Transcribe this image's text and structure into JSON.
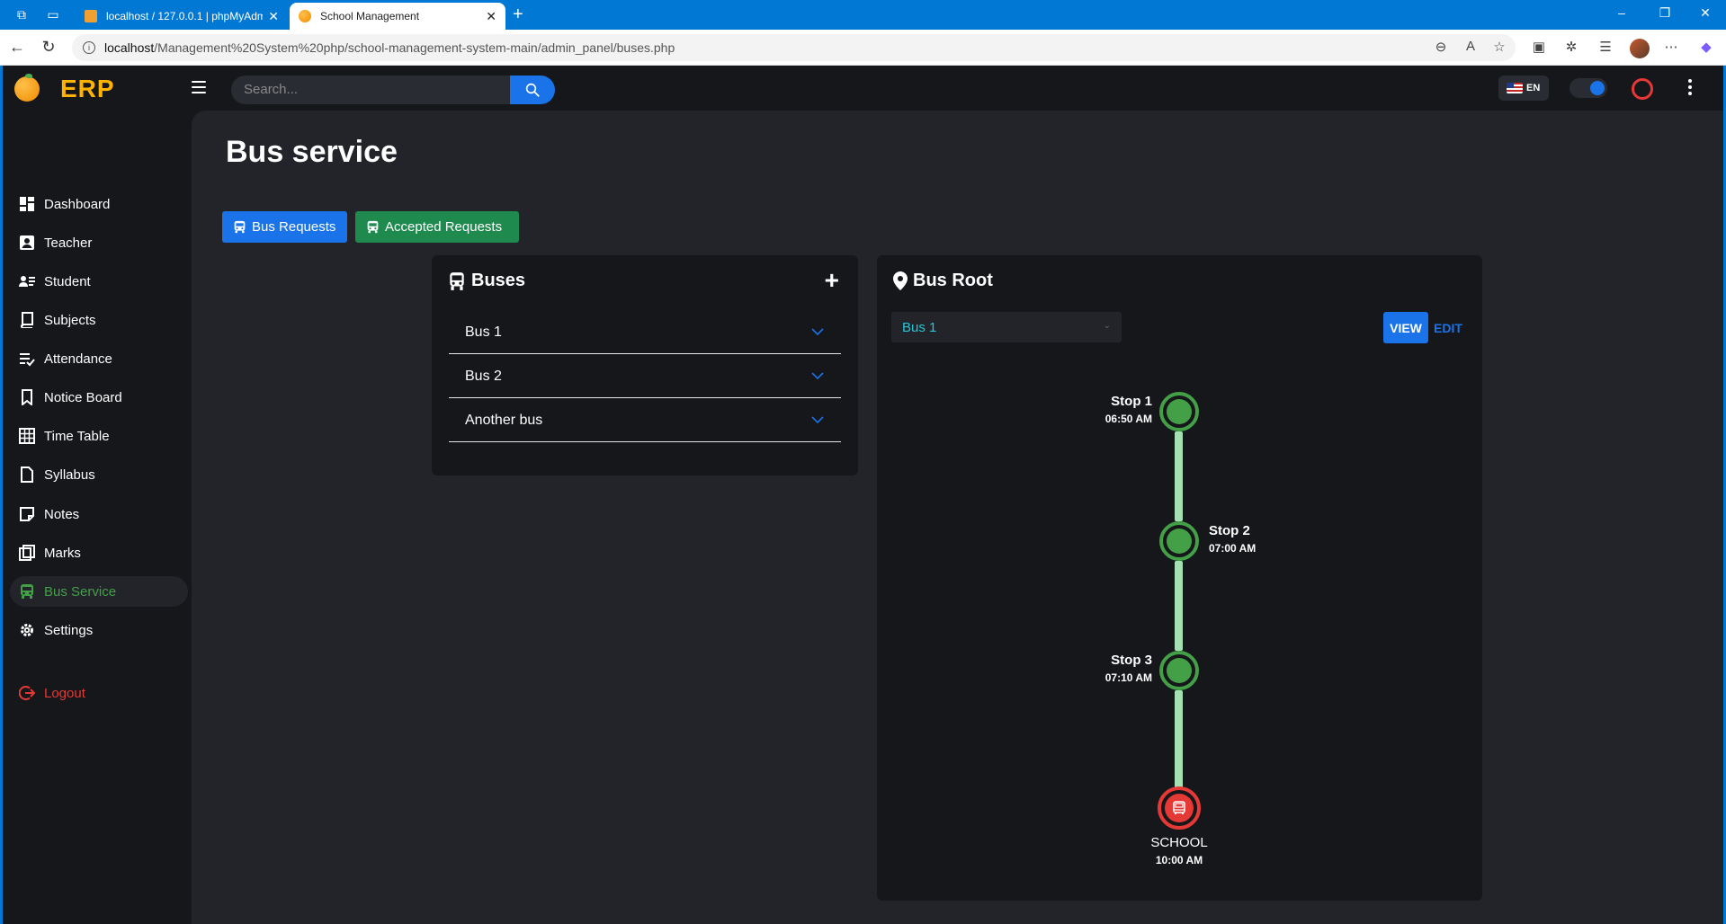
{
  "browser": {
    "tabs": [
      {
        "title": "localhost / 127.0.0.1 | phpMyAdmin",
        "active": false
      },
      {
        "title": "School Management",
        "active": true
      }
    ],
    "url_host": "localhost",
    "url_path": "/Management%20System%20php/school-management-system-main/admin_panel/buses.php"
  },
  "app": {
    "logo": "ERP",
    "search_placeholder": "Search...",
    "lang": "EN"
  },
  "sidebar": {
    "items": [
      {
        "label": "Dashboard",
        "icon": "dashboard-icon"
      },
      {
        "label": "Teacher",
        "icon": "teacher-icon"
      },
      {
        "label": "Student",
        "icon": "student-icon"
      },
      {
        "label": "Subjects",
        "icon": "book-icon"
      },
      {
        "label": "Attendance",
        "icon": "attendance-icon"
      },
      {
        "label": "Notice Board",
        "icon": "bookmark-icon"
      },
      {
        "label": "Time Table",
        "icon": "table-icon"
      },
      {
        "label": "Syllabus",
        "icon": "file-icon"
      },
      {
        "label": "Notes",
        "icon": "note-icon"
      },
      {
        "label": "Marks",
        "icon": "marks-icon"
      },
      {
        "label": "Bus Service",
        "icon": "bus-icon",
        "active": true
      },
      {
        "label": "Settings",
        "icon": "gear-icon"
      }
    ],
    "logout": "Logout"
  },
  "main": {
    "title": "Bus service",
    "buttons": {
      "bus_requests": "Bus Requests",
      "accepted_requests": "Accepted Requests"
    },
    "buses_card": {
      "title": "Buses",
      "items": [
        "Bus 1",
        "Bus 2",
        "Another bus"
      ]
    },
    "root_card": {
      "title": "Bus Root",
      "selected_bus": "Bus 1",
      "view_label": "VIEW",
      "edit_label": "EDIT",
      "stops": [
        {
          "name": "Stop 1",
          "time": "06:50 AM"
        },
        {
          "name": "Stop 2",
          "time": "07:00 AM"
        },
        {
          "name": "Stop 3",
          "time": "07:10 AM"
        }
      ],
      "destination": {
        "name": "SCHOOL",
        "time": "10:00 AM"
      }
    }
  },
  "colors": {
    "accent_blue": "#1a73e8",
    "accent_green": "#43a047",
    "danger_red": "#e53935",
    "logo_yellow": "#ffb300"
  }
}
